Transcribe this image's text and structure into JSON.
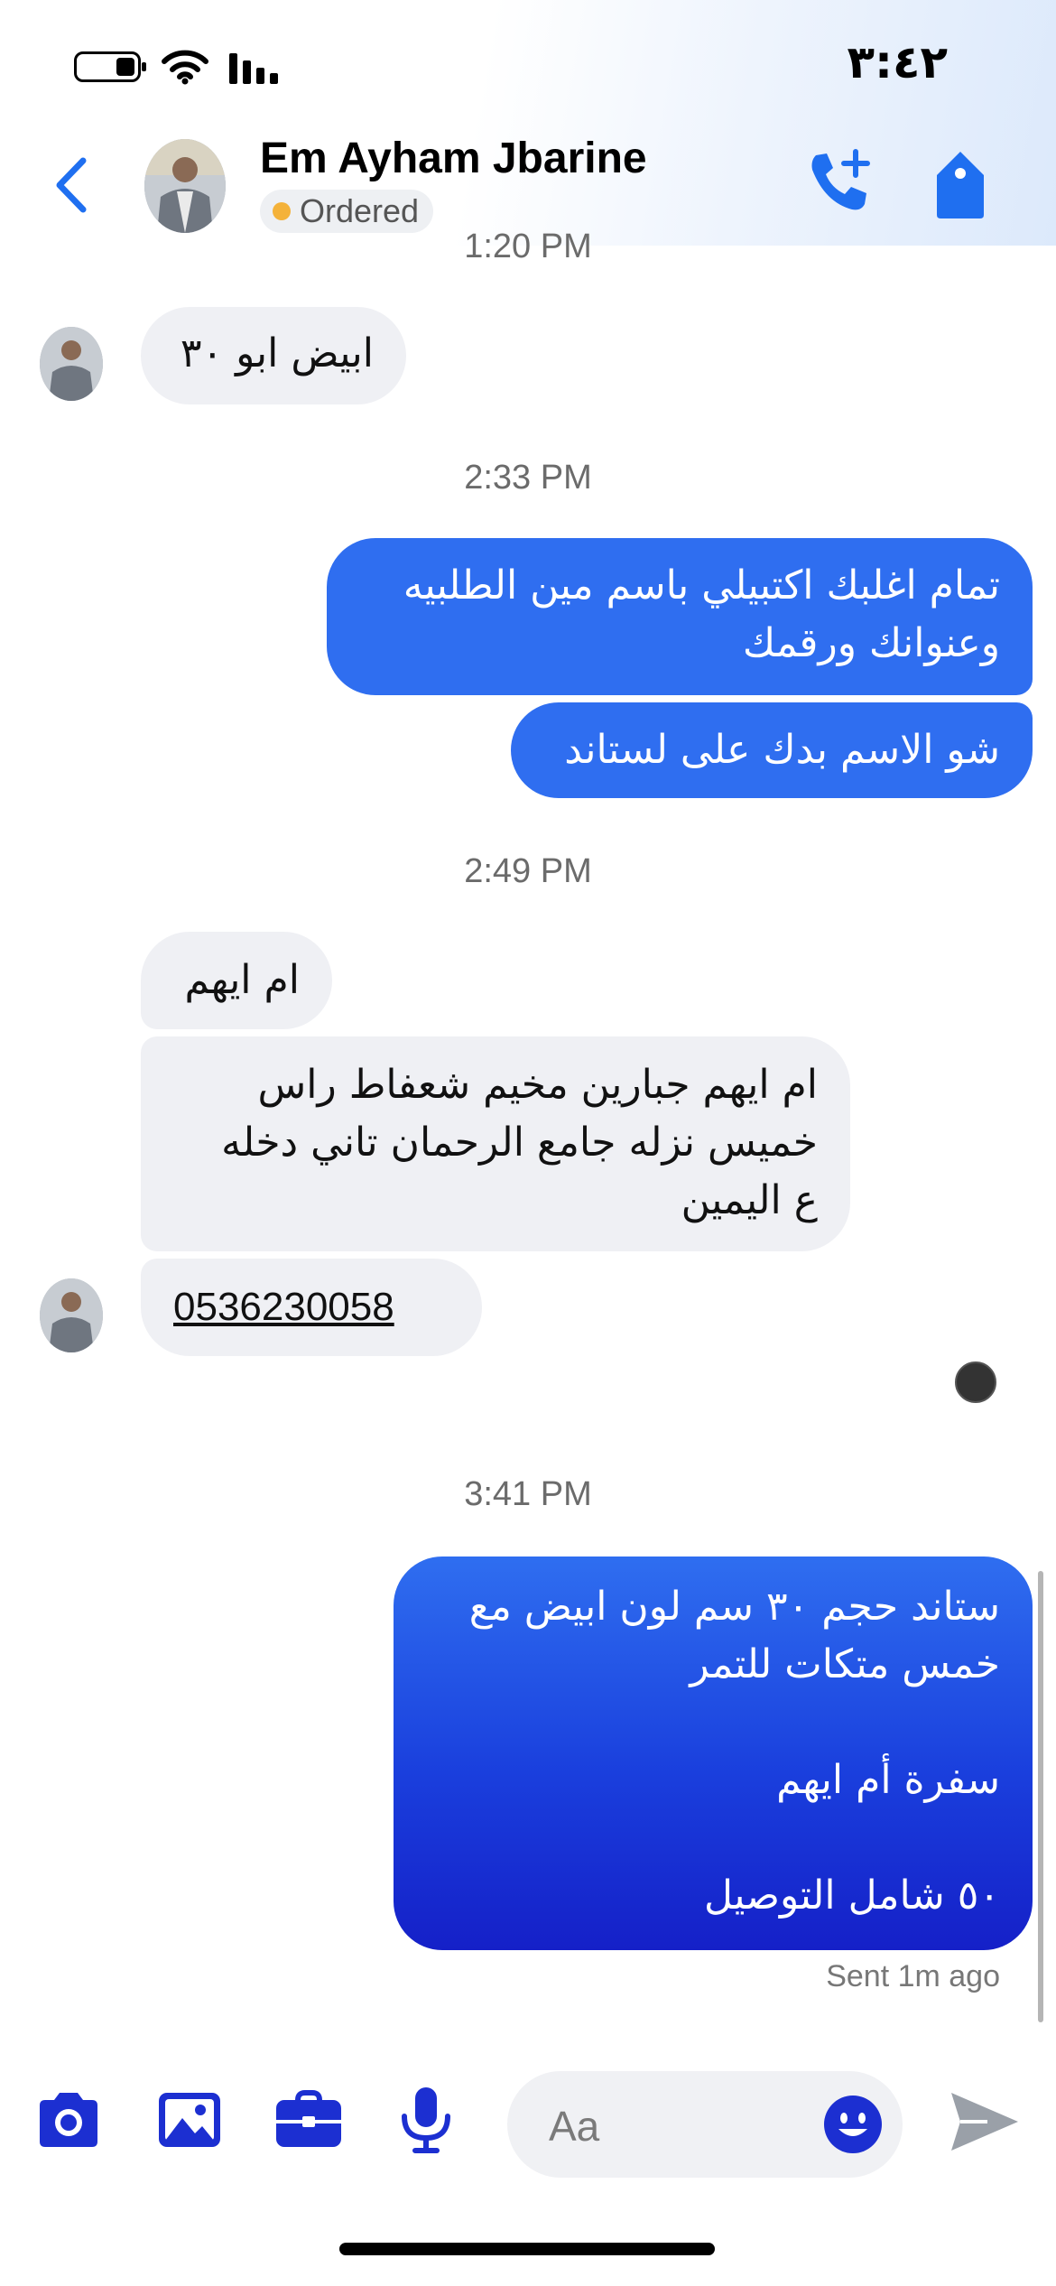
{
  "status_bar": {
    "time": "٣:٤٢"
  },
  "header": {
    "contact_name": "Em Ayham Jbarine",
    "badge_label": "Ordered"
  },
  "messages": {
    "partial_timestamp": "1:20 PM",
    "in_1": "ابيض ابو ٣٠",
    "ts_1": "2:33 PM",
    "out_1": "تمام اغلبك اكتبيلي باسم مين الطلبيه\nوعنوانك ورقمك",
    "out_2": "شو الاسم بدك على لستاند",
    "ts_2": "2:49 PM",
    "in_2": "ام ايهم",
    "in_3": "ام ايهم جبارين مخيم شعفاط راس\nخميس نزله جامع الرحمان تاني دخله\nع اليمين",
    "in_4": "0536230058",
    "ts_3": "3:41 PM",
    "out_3": "ستاند حجم ٣٠ سم لون ابيض مع\nخمس متكات للتمر\n\nسفرة أم ايهم\n\n٥٠ شامل التوصيل",
    "sent_status": "Sent 1m ago"
  },
  "composer": {
    "placeholder": "Aa"
  },
  "colors": {
    "accent": "#1f6ff0",
    "outgoing_bubble": "#2f6ef0",
    "outgoing_gradient_end": "#1520c8",
    "incoming_bubble": "#eff0f4",
    "composer_icons": "#1c2fd1",
    "badge_dot": "#f4b23a"
  },
  "icons": {
    "back": "chevron-left-icon",
    "call": "phone-plus-icon",
    "tag": "tag-icon",
    "camera": "camera-icon",
    "gallery": "image-icon",
    "briefcase": "briefcase-icon",
    "mic": "microphone-icon",
    "emoji": "smiley-icon",
    "send": "send-icon"
  }
}
